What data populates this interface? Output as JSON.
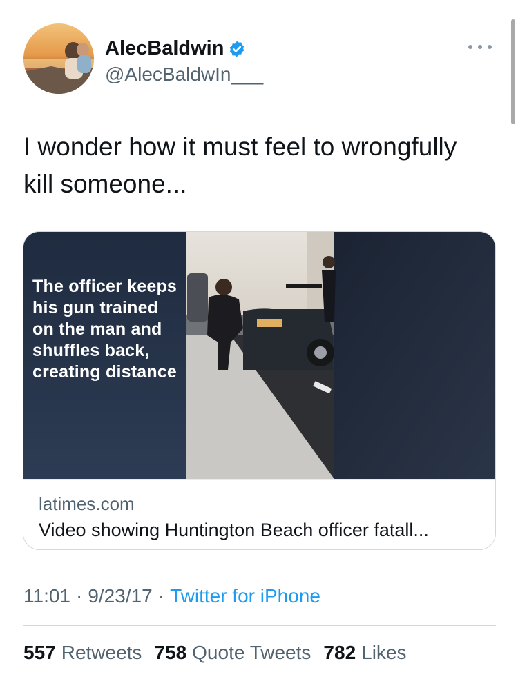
{
  "tweet": {
    "author": {
      "display_name": "AlecBaldwin",
      "handle": "@AlecBaldwIn___",
      "verified": true,
      "avatar_icon": "avatar-photo-icon",
      "verified_icon": "verified-badge-icon"
    },
    "more_icon": "more-options-icon",
    "text": "I wonder how it must feel to wrongfully kill someone...",
    "card": {
      "caption": "The officer keeps his gun trained on the man and shuffles back, creating distance",
      "domain": "latimes.com",
      "title": "Video showing Huntington Beach officer fatall..."
    },
    "meta": {
      "time": "11:01",
      "date": "9/23/17",
      "separator": "·",
      "source": "Twitter for iPhone"
    },
    "stats": {
      "retweets_count": "557",
      "retweets_label": "Retweets",
      "quotes_count": "758",
      "quotes_label": "Quote Tweets",
      "likes_count": "782",
      "likes_label": "Likes"
    }
  },
  "colors": {
    "link": "#1d9bf0",
    "secondary_text": "#536471",
    "primary_text": "#0f1419",
    "divider": "#cfd9de",
    "verified": "#1d9bf0"
  }
}
